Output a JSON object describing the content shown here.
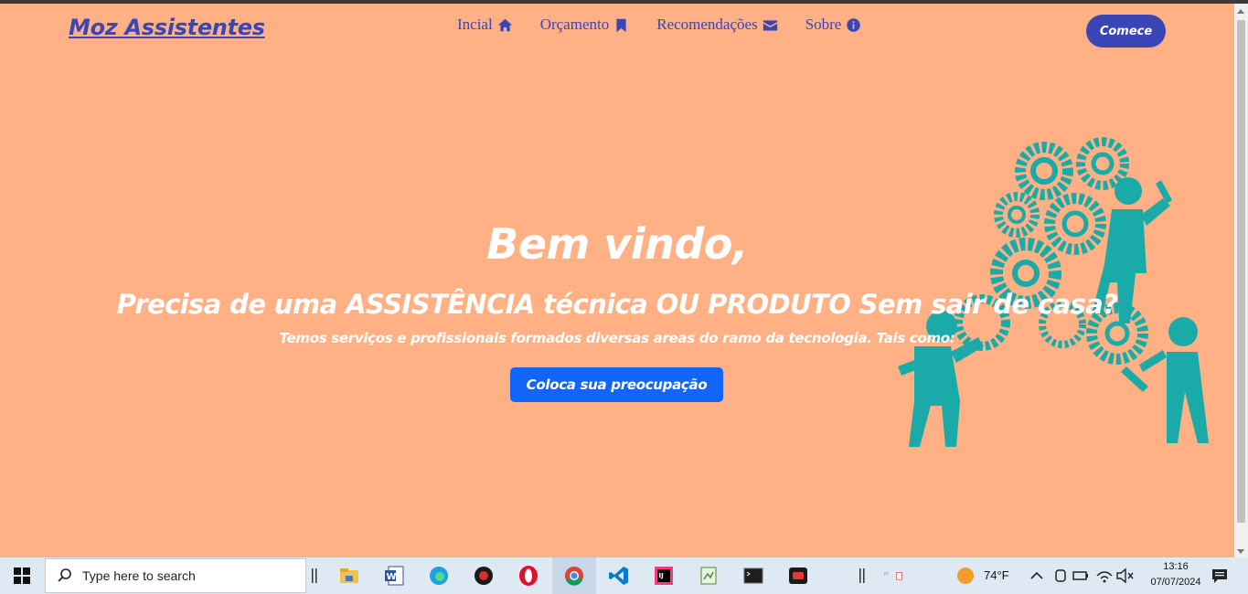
{
  "brand": "Moz Assistentes",
  "nav": [
    {
      "label": "Incial",
      "icon": "home-icon"
    },
    {
      "label": "Orçamento",
      "icon": "bookmark-icon"
    },
    {
      "label": "Recomendações",
      "icon": "envelope-icon"
    },
    {
      "label": "Sobre",
      "icon": "info-circle-icon"
    }
  ],
  "start_button": "Comece",
  "hero": {
    "title": "Bem vindo,",
    "subtitle": "Precisa de uma ASSISTÊNCIA técnica OU PRODUTO Sem sair de casa?",
    "description": "Temos serviços e profissionais formados diversas areas do ramo da tecnologia. Tais como:",
    "cta": "Coloca sua preocupação"
  },
  "colors": {
    "page_bg": "#ffb084",
    "brand_blue": "#3a46b5",
    "cta_blue": "#1166f7",
    "illustration_teal": "#1aaba8"
  },
  "taskbar": {
    "search_placeholder": "Type here to search",
    "apps": [
      "file-explorer-icon",
      "word-icon",
      "edge-icon",
      "app-icon",
      "opera-icon",
      "chrome-icon",
      "vscode-icon",
      "intellij-icon",
      "notepad-icon",
      "terminal-icon",
      "recorder-icon"
    ],
    "weather": "74°F",
    "time": "13:16",
    "date": "07/07/2024"
  }
}
